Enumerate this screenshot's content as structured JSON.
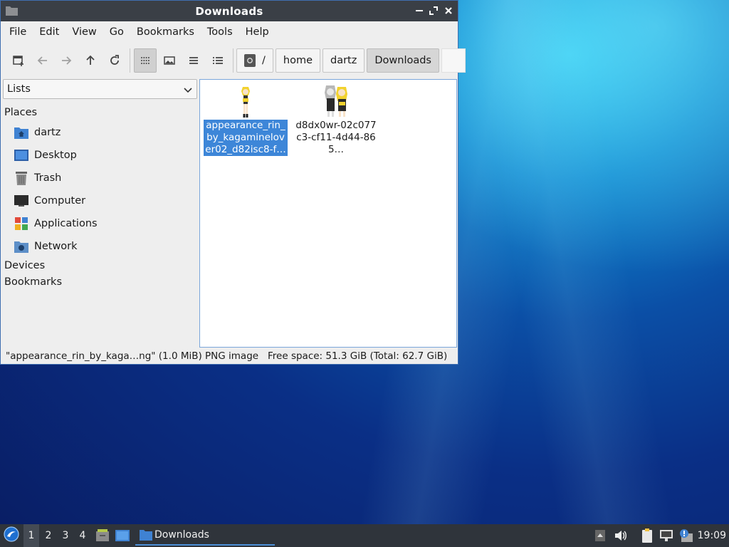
{
  "window": {
    "title": "Downloads"
  },
  "menubar": {
    "items": [
      "File",
      "Edit",
      "View",
      "Go",
      "Bookmarks",
      "Tools",
      "Help"
    ]
  },
  "toolbar": {
    "icons": [
      "new-tab-icon",
      "back-icon",
      "forward-icon",
      "up-icon",
      "reload-icon",
      "icon-view-icon",
      "thumbnail-view-icon",
      "compact-view-icon",
      "detailed-list-icon"
    ],
    "path": {
      "root": "/",
      "segments": [
        "home",
        "dartz",
        "Downloads"
      ]
    }
  },
  "sidebar": {
    "mode": "Lists",
    "places_label": "Places",
    "places": [
      {
        "label": "dartz",
        "icon": "home-folder-icon"
      },
      {
        "label": "Desktop",
        "icon": "desktop-icon"
      },
      {
        "label": "Trash",
        "icon": "trash-icon"
      },
      {
        "label": "Computer",
        "icon": "computer-icon"
      },
      {
        "label": "Applications",
        "icon": "applications-icon"
      },
      {
        "label": "Network",
        "icon": "network-folder-icon"
      }
    ],
    "devices_label": "Devices",
    "bookmarks_label": "Bookmarks"
  },
  "files": [
    {
      "name": "appearance_rin_by_kagaminelover02_d82isc8-f…",
      "selected": true
    },
    {
      "name": "d8dx0wr-02c077c3-cf11-4d44-865…",
      "selected": false
    }
  ],
  "status": {
    "selection": "\"appearance_rin_by_kaga…ng\" (1.0 MiB) PNG image",
    "free_space": "Free space: 51.3 GiB (Total: 62.7 GiB)"
  },
  "taskbar": {
    "desktops": [
      "1",
      "2",
      "3",
      "4"
    ],
    "task_label": "Downloads",
    "clock": "19:09"
  },
  "colors": {
    "titlebar": "#3a3f46",
    "selection": "#3d86d8",
    "taskbar": "#2f343b"
  }
}
